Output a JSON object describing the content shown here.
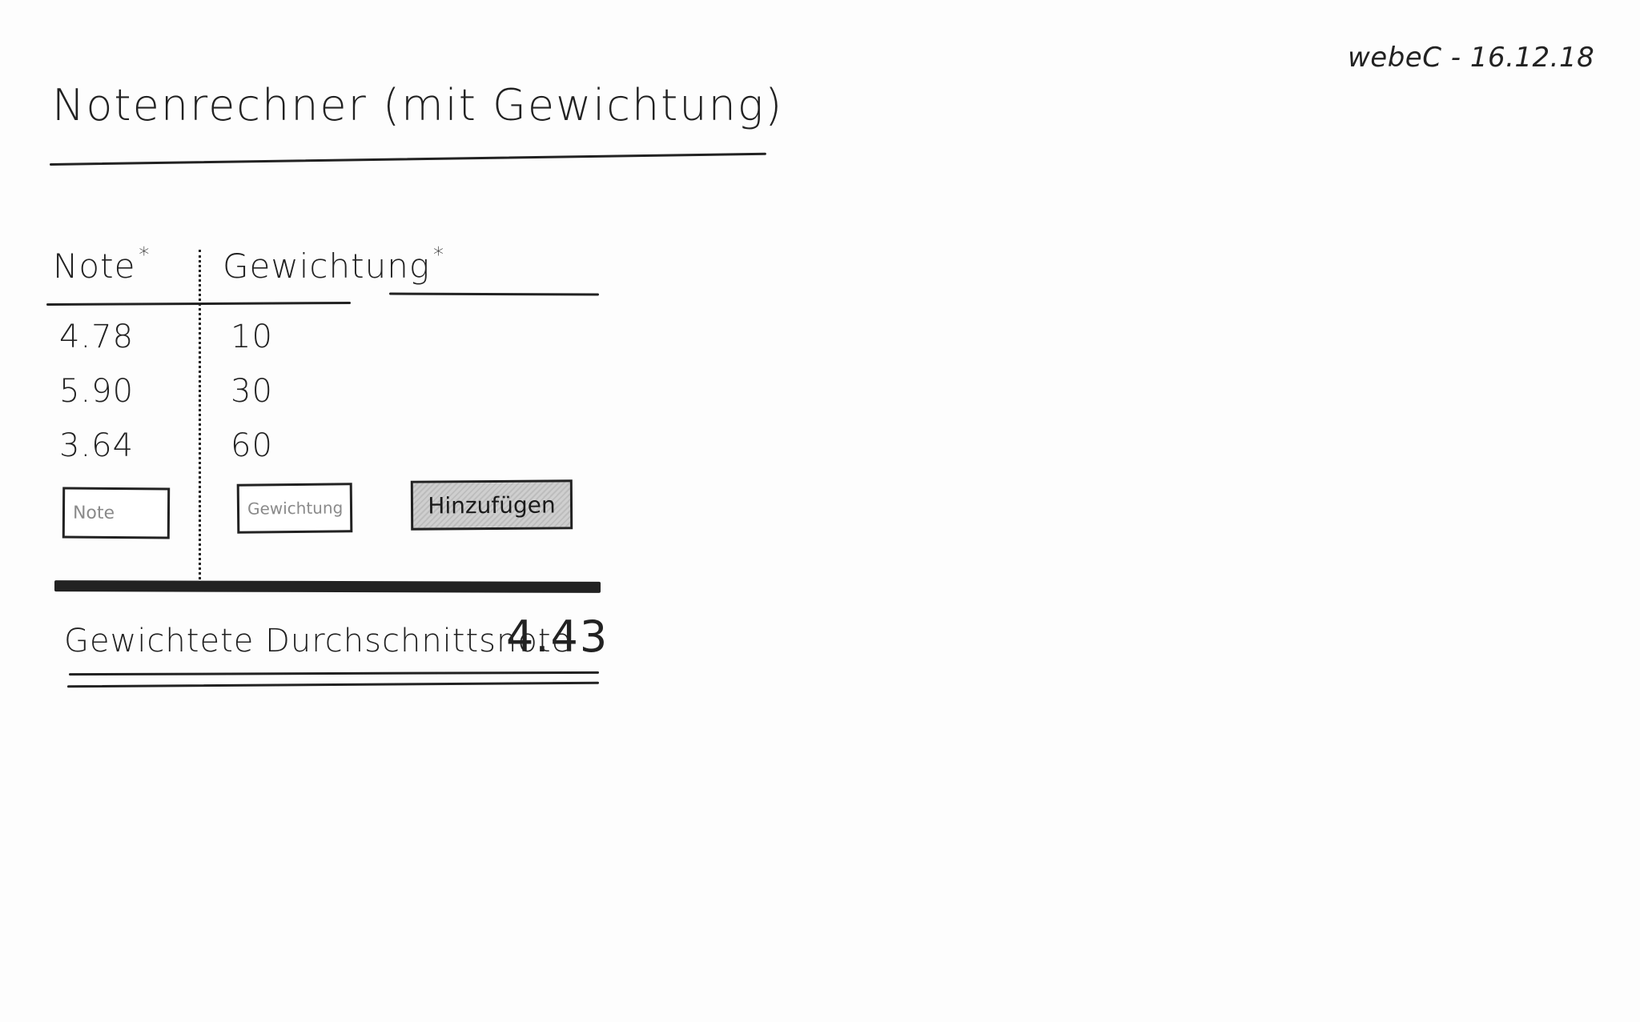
{
  "signature": "webeC - 16.12.18",
  "title": "Notenrechner (mit Gewichtung)",
  "table": {
    "headers": {
      "note": "Note",
      "note_marker": "*",
      "weight": "Gewichtung",
      "weight_marker": "*"
    },
    "rows": [
      {
        "note": "4.78",
        "weight": "10"
      },
      {
        "note": "5.90",
        "weight": "30"
      },
      {
        "note": "3.64",
        "weight": "60"
      }
    ]
  },
  "form": {
    "note_placeholder": "Note",
    "weight_placeholder": "Gewichtung",
    "add_label": "Hinzufügen"
  },
  "result": {
    "label": "Gewichtete Durchschnittsnote",
    "value": "4.43"
  }
}
